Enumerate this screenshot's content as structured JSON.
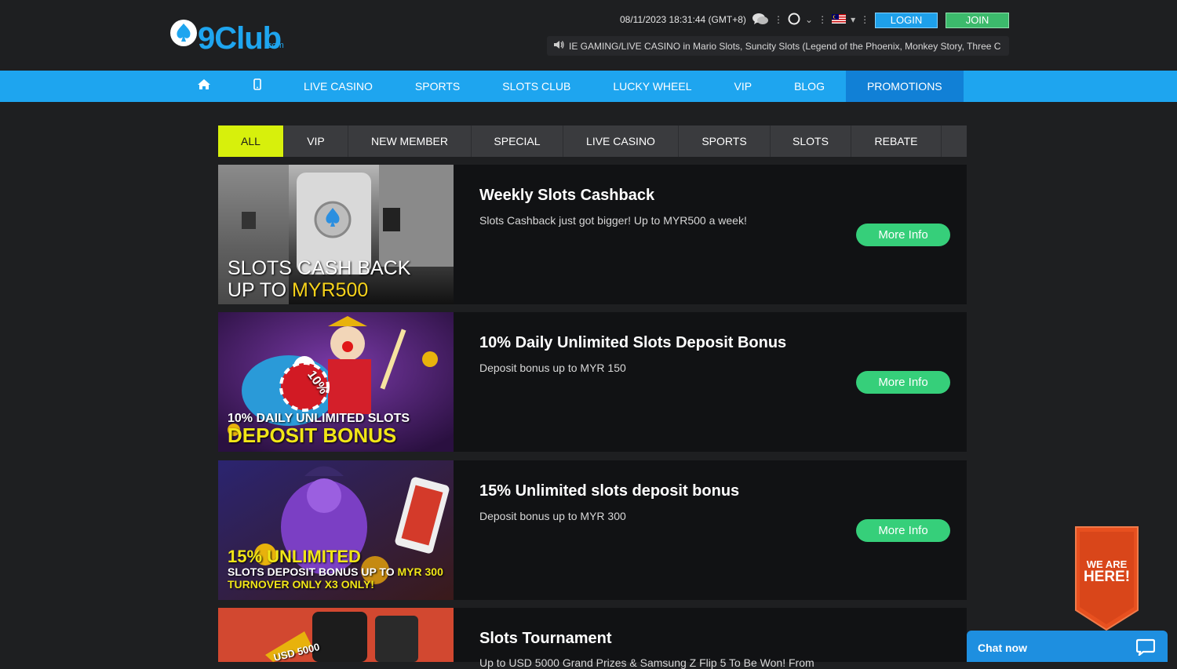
{
  "header": {
    "logo_text": "9Club",
    "logo_suffix": ".com",
    "datetime": "08/11/2023 18:31:44 (GMT+8)",
    "login_label": "LOGIN",
    "join_label": "JOIN",
    "marquee": "IE GAMING/LIVE CASINO in Mario Slots, Suncity Slots (Legend of the Phoenix, Monkey Story, Three C"
  },
  "nav": {
    "items": [
      {
        "label": "LIVE CASINO"
      },
      {
        "label": "SPORTS"
      },
      {
        "label": "SLOTS CLUB"
      },
      {
        "label": "LUCKY WHEEL"
      },
      {
        "label": "VIP"
      },
      {
        "label": "BLOG"
      },
      {
        "label": "PROMOTIONS"
      }
    ]
  },
  "tabs": [
    {
      "label": "ALL"
    },
    {
      "label": "VIP"
    },
    {
      "label": "NEW MEMBER"
    },
    {
      "label": "SPECIAL"
    },
    {
      "label": "LIVE CASINO"
    },
    {
      "label": "SPORTS"
    },
    {
      "label": "SLOTS"
    },
    {
      "label": "REBATE"
    }
  ],
  "promos": [
    {
      "title": "Weekly Slots Cashback",
      "desc": "Slots Cashback just got bigger! Up to MYR500 a week!",
      "more": "More Info",
      "banner_line1": "SLOTS CASH BACK",
      "banner_line2a": "UP TO ",
      "banner_line2b": "MYR500"
    },
    {
      "title": "10% Daily Unlimited Slots Deposit Bonus",
      "desc": "Deposit bonus up to MYR 150",
      "more": "More Info",
      "banner_line1": "10% DAILY UNLIMITED SLOTS",
      "banner_line2": "DEPOSIT BONUS",
      "chip_text": "10%"
    },
    {
      "title": "15% Unlimited slots deposit bonus",
      "desc": "Deposit bonus up to MYR 300",
      "more": "More Info",
      "banner_line1": "15% UNLIMITED",
      "banner_line2a": "SLOTS DEPOSIT BONUS UP TO ",
      "banner_line2b": "MYR 300",
      "banner_line3": "TURNOVER ONLY X3 ONLY!"
    },
    {
      "title": "Slots Tournament",
      "desc": "Up to USD 5000 Grand Prizes & Samsung Z Flip 5 To Be Won! From",
      "banner_text": "USD 5000"
    }
  ],
  "badge": {
    "line1": "WE ARE",
    "line2": "HERE!"
  },
  "chat": {
    "label": "Chat now"
  },
  "colors": {
    "nav_bg": "#1ea5ef",
    "nav_active": "#1180d6",
    "tab_active": "#d7f00c",
    "more_btn": "#36cf7a",
    "login": "#1ea0ea",
    "join": "#3cba6c",
    "badge": "#e8501f"
  }
}
